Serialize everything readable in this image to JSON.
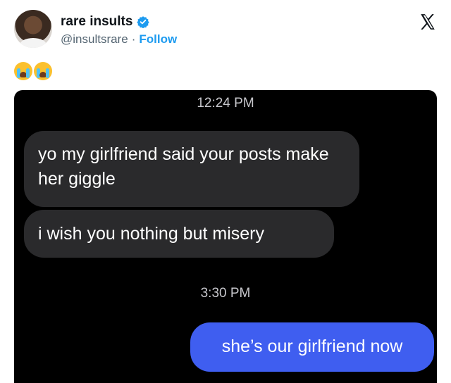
{
  "tweet": {
    "display_name": "rare insults",
    "handle": "@insultsrare",
    "separator": "·",
    "follow_label": "Follow",
    "text": "😭😭",
    "verified_color": "#1d9bf0"
  },
  "conversation": {
    "messages_group_1_time": "12:24 PM",
    "incoming_1": "yo my girlfriend said your posts make her giggle",
    "incoming_2": "i wish you nothing but misery",
    "messages_group_2_time": "3:30 PM",
    "outgoing_1": "she’s our girlfriend now",
    "incoming_color": "#2a2a2c",
    "outgoing_color": "#3f5ef0"
  },
  "icons": [
    "avatar",
    "verified-badge-icon",
    "x-logo-icon",
    "loudly-crying-face-emoji"
  ]
}
